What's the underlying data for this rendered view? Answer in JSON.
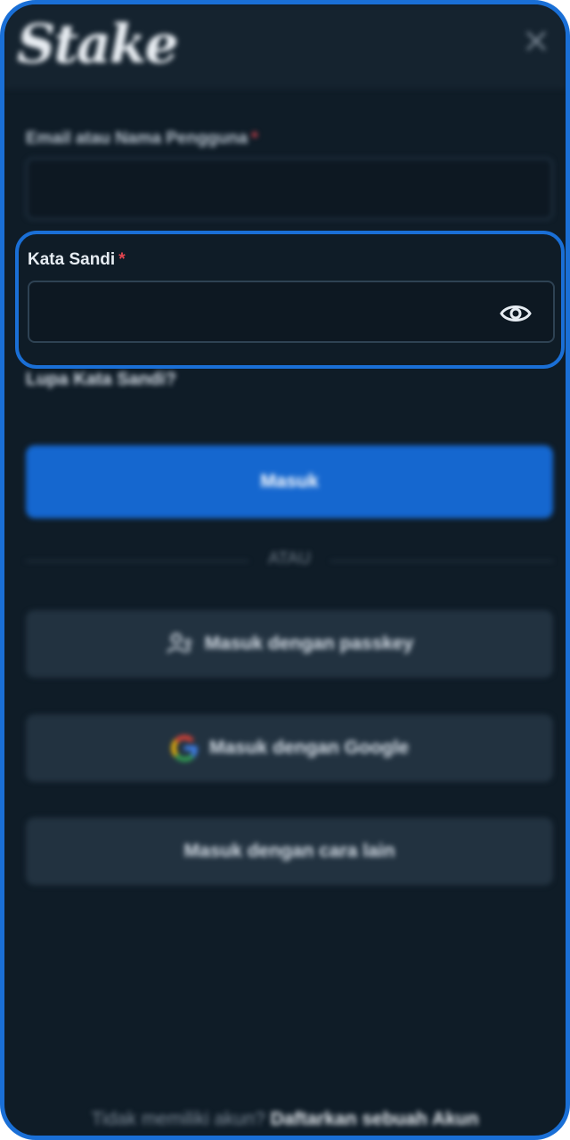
{
  "header": {
    "logo_text": "Stake",
    "close_icon": "close-icon"
  },
  "form": {
    "username_label": "Email atau Nama Pengguna",
    "username_required": "*",
    "username_value": "",
    "password_label": "Kata Sandi",
    "password_required": "*",
    "password_value": "",
    "forgot_password": "Lupa Kata Sandi?",
    "submit_label": "Masuk"
  },
  "divider_text": "ATAU",
  "alt_logins": {
    "passkey_label": "Masuk dengan passkey",
    "google_label": "Masuk dengan Google",
    "other_label": "Masuk dengan cara lain"
  },
  "footer": {
    "prompt": "Tidak memiliki akun?",
    "register_link": "Daftarkan sebuah Akun"
  },
  "colors": {
    "accent": "#1a6fd6",
    "primary_button": "#1567cf",
    "background": "#0f1c27",
    "required": "#e3454f"
  }
}
